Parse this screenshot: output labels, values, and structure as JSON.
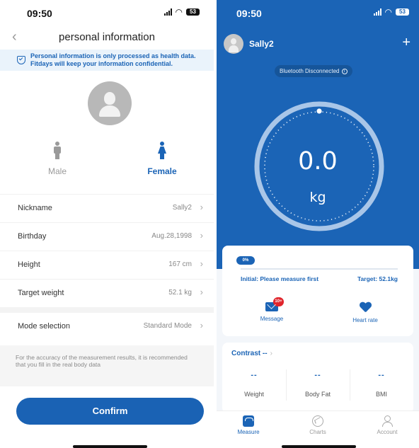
{
  "left": {
    "status": {
      "time": "09:50",
      "battery": "53"
    },
    "nav": {
      "title": "personal information",
      "back_icon": "chevron-left-icon"
    },
    "notice": {
      "text": "Personal information is only processed as health data. Fitdays will keep your information confidential.",
      "icon": "shield-icon"
    },
    "gender": {
      "male_label": "Male",
      "female_label": "Female",
      "selected": "Female"
    },
    "rows": [
      {
        "label": "Nickname",
        "value": "Sally2"
      },
      {
        "label": "Birthday",
        "value": "Aug.28,1998"
      },
      {
        "label": "Height",
        "value": "167 cm"
      },
      {
        "label": "Target weight",
        "value": "52.1 kg"
      }
    ],
    "mode_row": {
      "label": "Mode selection",
      "value": "Standard Mode"
    },
    "hint": "For the accuracy of the measurement results, it is recommended that you fill in the real body data",
    "confirm_label": "Confirm"
  },
  "right": {
    "status": {
      "time": "09:50",
      "battery": "53"
    },
    "user": {
      "name": "Sally2"
    },
    "bluetooth": {
      "text": "Bluetooth Disconnected"
    },
    "weight": {
      "value": "0.0",
      "unit": "kg"
    },
    "progress": {
      "percent_label": "0%",
      "fraction": 0.0,
      "initial_text": "Initial: Please measure first",
      "target_text": "Target: 52.1kg"
    },
    "actions": [
      {
        "label": "Message",
        "badge": "10+",
        "icon": "mail-icon"
      },
      {
        "label": "Heart rate",
        "icon": "heart-icon"
      }
    ],
    "contrast": {
      "title": "Contrast --",
      "metrics": [
        {
          "value": "--",
          "label": "Weight"
        },
        {
          "value": "--",
          "label": "Body Fat"
        },
        {
          "value": "--",
          "label": "BMI"
        }
      ]
    },
    "tabs": [
      {
        "label": "Measure",
        "icon": "scale-icon",
        "active": true
      },
      {
        "label": "Charts",
        "icon": "chart-icon",
        "active": false
      },
      {
        "label": "Account",
        "icon": "account-icon",
        "active": false
      }
    ]
  },
  "colors": {
    "brand_blue": "#1b64b6",
    "badge_red": "#e0242b",
    "notice_bg": "#eaf3fb"
  }
}
